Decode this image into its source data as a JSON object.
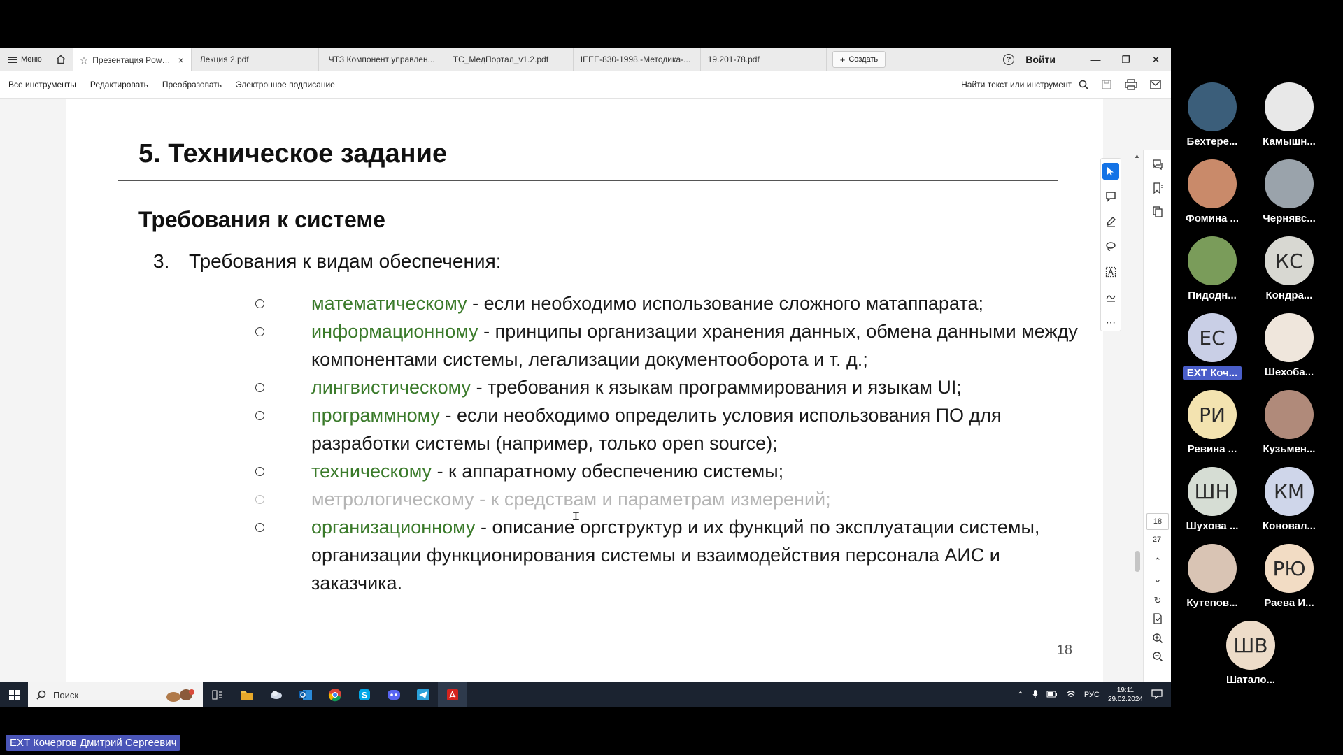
{
  "tabbar": {
    "menu_label": "Меню",
    "tabs": [
      {
        "label": "Презентация Power..."
      },
      {
        "label": "Лекция 2.pdf"
      },
      {
        "label": "ЧТЗ Компонент управлен..."
      },
      {
        "label": "ТС_МедПортал_v1.2.pdf"
      },
      {
        "label": "IEEE-830-1998.-Методика-..."
      },
      {
        "label": "19.201-78.pdf"
      }
    ],
    "create_label": "Создать",
    "signin_label": "Войти"
  },
  "toolbar": {
    "items": [
      "Все инструменты",
      "Редактировать",
      "Преобразовать",
      "Электронное подписание"
    ],
    "find_label": "Найти текст или инструмент"
  },
  "slide": {
    "title": "5. Техническое задание",
    "subtitle": "Требования к системе",
    "item_number": "3.",
    "item_text": "Требования к видам обеспечения:",
    "bullets": [
      {
        "term": "математическому",
        "text": " - если необходимо использование сложного матаппарата;"
      },
      {
        "term": "информационному",
        "text": " - принципы организации хранения данных, обмена данными между компонентами системы, легализации документооборота и т. д.;"
      },
      {
        "term": "лингвистическому",
        "text": " - требования к языкам программирования и языкам UI;"
      },
      {
        "term": "программному",
        "text": " - если необходимо определить условия использования ПО для разработки системы (например, только open source);"
      },
      {
        "term": "техническому",
        "text": " - к аппаратному обеспечению системы;"
      },
      {
        "term": "метрологическому",
        "text": " - к средствам и параметрам измерений;"
      },
      {
        "term": "организационному",
        "text": " - описание оргструктур и их функций по эксплуатации системы, организации функционирования системы и взаимодействия персонала АИС и заказчика."
      }
    ],
    "page_number": "18"
  },
  "pager": {
    "current": "18",
    "total": "27"
  },
  "taskbar": {
    "search_placeholder": "Поиск",
    "lang": "РУС",
    "time": "19:11",
    "date": "29.02.2024"
  },
  "participants": [
    {
      "name": "Бехтере...",
      "initials": "",
      "bg": "#3b5e7a"
    },
    {
      "name": "Камышн...",
      "initials": "",
      "bg": "#e8e8e8"
    },
    {
      "name": "Фомина ...",
      "initials": "",
      "bg": "#c98a6a"
    },
    {
      "name": "Чернявс...",
      "initials": "",
      "bg": "#9aa3ab"
    },
    {
      "name": "Пидодн...",
      "initials": "",
      "bg": "#7a9c5a"
    },
    {
      "name": "Кондра...",
      "initials": "КС",
      "bg": "#d8d8d2"
    },
    {
      "name": "EXT Коч...",
      "initials": "ЕС",
      "bg": "#c9cfe6",
      "highlight": true
    },
    {
      "name": "Шехоба...",
      "initials": "",
      "bg": "#efe6dc"
    },
    {
      "name": "Ревина ...",
      "initials": "РИ",
      "bg": "#f3e3b0"
    },
    {
      "name": "Кузьмен...",
      "initials": "",
      "bg": "#b08a7a"
    },
    {
      "name": "Шухова ...",
      "initials": "ШН",
      "bg": "#d6ddd4"
    },
    {
      "name": "Коновал...",
      "initials": "КМ",
      "bg": "#cfd6ea"
    },
    {
      "name": "Кутепов...",
      "initials": "",
      "bg": "#d9c4b4"
    },
    {
      "name": "Раева И...",
      "initials": "РЮ",
      "bg": "#f2dcc4"
    },
    {
      "name": "Шатало...",
      "initials": "ШВ",
      "bg": "#eddcc9"
    }
  ],
  "speaker_tag": "EXT Кочергов Дмитрий Сергеевич"
}
